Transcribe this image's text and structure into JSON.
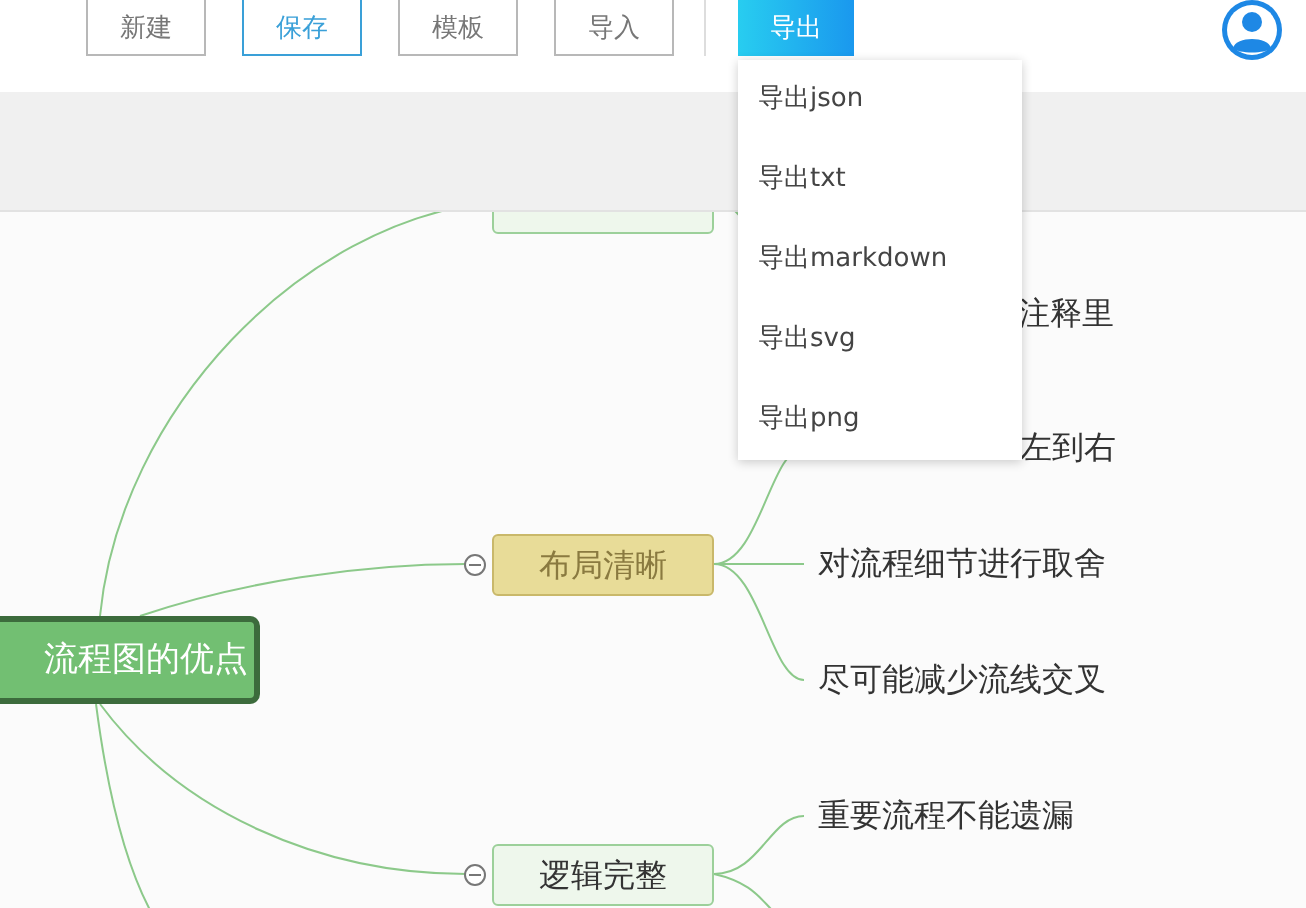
{
  "toolbar": {
    "buttons": [
      {
        "label": "新建",
        "kind": "default"
      },
      {
        "label": "保存",
        "kind": "outline"
      },
      {
        "label": "模板",
        "kind": "default"
      },
      {
        "label": "导入",
        "kind": "default"
      },
      {
        "label": "导出",
        "kind": "primary"
      }
    ]
  },
  "export_menu": {
    "items": [
      "导出json",
      "导出txt",
      "导出markdown",
      "导出svg",
      "导出png"
    ]
  },
  "mindmap": {
    "root": "流程图的优点",
    "branches": [
      {
        "color": "#eef7ec",
        "children": [
          "注释里"
        ]
      },
      {
        "label": "布局清晰",
        "color": "#e8dc98",
        "expanded": true,
        "children": [
          "左到右",
          "对流程细节进行取舍",
          "尽可能减少流线交叉"
        ]
      },
      {
        "label": "逻辑完整",
        "color": "#eef7ec",
        "expanded": true,
        "children": [
          "重要流程不能遗漏"
        ]
      }
    ]
  }
}
